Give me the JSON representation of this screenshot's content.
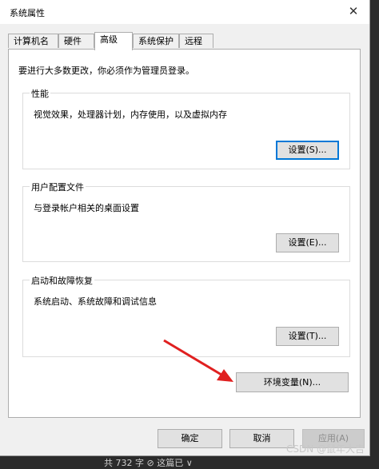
{
  "window": {
    "title": "系统属性",
    "close_glyph": "✕"
  },
  "tabs": [
    {
      "label": "计算机名"
    },
    {
      "label": "硬件"
    },
    {
      "label": "高级",
      "active": true
    },
    {
      "label": "系统保护"
    },
    {
      "label": "远程"
    }
  ],
  "admin_note": "要进行大多数更改，你必须作为管理员登录。",
  "groups": {
    "performance": {
      "title": "性能",
      "desc": "视觉效果，处理器计划，内存使用，以及虚拟内存",
      "button": "设置(S)..."
    },
    "user_profiles": {
      "title": "用户配置文件",
      "desc": "与登录帐户相关的桌面设置",
      "button": "设置(E)..."
    },
    "startup_recovery": {
      "title": "启动和故障恢复",
      "desc": "系统启动、系统故障和调试信息",
      "button": "设置(T)..."
    }
  },
  "env_button": "环境变量(N)...",
  "footer": {
    "ok": "确定",
    "cancel": "取消",
    "apply": "应用(A)"
  },
  "watermark": "CSDN @鼠年大吉",
  "bottom_fragment": "共 732 字   ⊘ 这篇已 ∨",
  "colors": {
    "accent": "#0078d7",
    "arrow": "#e02020"
  }
}
